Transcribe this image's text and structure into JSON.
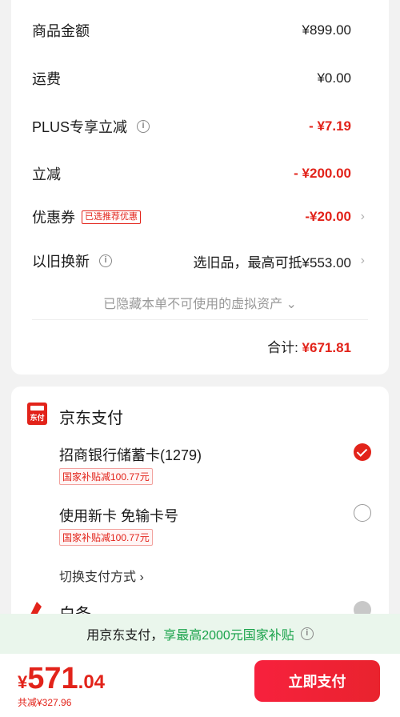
{
  "summary": {
    "rows": [
      {
        "label": "商品金额",
        "value": "¥899.00"
      },
      {
        "label": "运费",
        "value": "¥0.00"
      },
      {
        "label": "PLUS专享立减",
        "value": "- ¥7.19"
      },
      {
        "label": "立减",
        "value": "- ¥200.00"
      },
      {
        "label": "优惠券",
        "tag": "已选推荐优惠",
        "value": "-¥20.00"
      },
      {
        "label": "以旧换新",
        "value": "选旧品，最高可抵¥553.00"
      }
    ],
    "hidden_assets": "已隐藏本单不可使用的虚拟资产",
    "total_label": "合计:",
    "total_value": "¥671.81"
  },
  "payment": {
    "logo_text": "东付",
    "title": "京东支付",
    "options": [
      {
        "label": "招商银行储蓄卡(1279)",
        "subsidy": "国家补贴减100.77元",
        "selected": true
      },
      {
        "label": "使用新卡 免输卡号",
        "subsidy": "国家补贴减100.77元",
        "selected": false
      }
    ],
    "switch_label": "切换支付方式",
    "next_option_label": "白条"
  },
  "banner": {
    "text_part1": "用京东支付，",
    "text_part2": "享最高2000元国家补贴"
  },
  "bottom_bar": {
    "currency": "¥",
    "price_int": "571",
    "price_dec": ".04",
    "saved": "共减¥327.96",
    "pay_button": "立即支付"
  },
  "colors": {
    "accent_red": "#e2231a",
    "green": "#19a24a",
    "banner_bg": "#eaf6ec"
  }
}
